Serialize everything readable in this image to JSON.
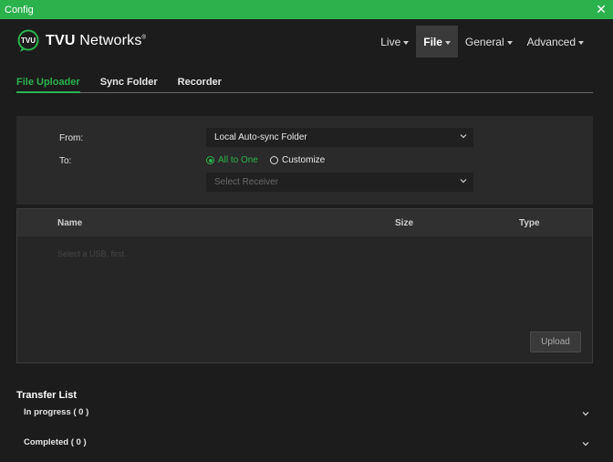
{
  "window": {
    "title": "Config",
    "close_glyph": "✕"
  },
  "brand": {
    "badge_text": "TVU",
    "name_bold": "TVU",
    "name_rest": " Networks",
    "trademark": "®",
    "accent_color": "#2bb24c"
  },
  "top_nav": {
    "items": [
      {
        "label": "Live",
        "active": false
      },
      {
        "label": "File",
        "active": true
      },
      {
        "label": "General",
        "active": false
      },
      {
        "label": "Advanced",
        "active": false
      }
    ]
  },
  "sub_tabs": [
    {
      "label": "File Uploader",
      "active": true
    },
    {
      "label": "Sync Folder",
      "active": false
    },
    {
      "label": "Recorder",
      "active": false
    }
  ],
  "form": {
    "from_label": "From:",
    "from_value": "Local Auto-sync Folder",
    "to_label": "To:",
    "radio_all_to_one": "All to One",
    "radio_customize": "Customize",
    "selected_radio": "All to One",
    "receiver_placeholder": "Select Receiver"
  },
  "file_table": {
    "columns": [
      "Name",
      "Size",
      "Type"
    ],
    "empty_message": "Select a USB, first.",
    "upload_button": "Upload"
  },
  "transfer_list": {
    "title": "Transfer List",
    "sections": [
      {
        "label": "In progress ( 0 )"
      },
      {
        "label": "Completed ( 0 )"
      }
    ]
  },
  "icons": {
    "close": "close-icon",
    "nav_caret": "caret-down-icon",
    "select_chevron": "chevron-down-icon",
    "logo": "tvu-logo-icon"
  }
}
